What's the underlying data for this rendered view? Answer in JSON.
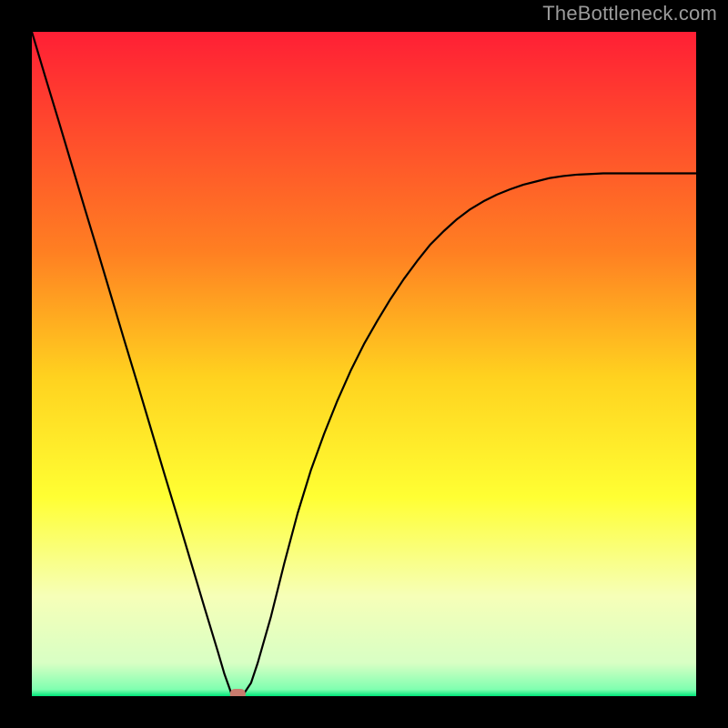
{
  "watermark": "TheBottleneck.com",
  "chart_data": {
    "type": "line",
    "title": "",
    "xlabel": "",
    "ylabel": "",
    "xlim": [
      0,
      100
    ],
    "ylim": [
      0,
      100
    ],
    "x": [
      0,
      2,
      4,
      6,
      8,
      10,
      12,
      14,
      16,
      18,
      20,
      22,
      24,
      26,
      28,
      29,
      30,
      31,
      32,
      33,
      34,
      36,
      38,
      40,
      42,
      44,
      46,
      48,
      50,
      52,
      54,
      56,
      58,
      60,
      62,
      64,
      66,
      68,
      70,
      72,
      74,
      76,
      78,
      80,
      82,
      84,
      86,
      88,
      90,
      92,
      94,
      96,
      98,
      100
    ],
    "values": [
      100,
      93.3,
      86.7,
      80.0,
      73.3,
      66.7,
      60.0,
      53.3,
      46.7,
      40.0,
      33.3,
      26.7,
      20.0,
      13.3,
      6.7,
      3.3,
      0.5,
      0.0,
      0.5,
      2.0,
      5.0,
      12.0,
      20.0,
      27.5,
      34.0,
      39.5,
      44.5,
      49.0,
      53.0,
      56.5,
      59.8,
      62.8,
      65.5,
      68.0,
      70.0,
      71.8,
      73.3,
      74.5,
      75.5,
      76.3,
      77.0,
      77.5,
      78.0,
      78.3,
      78.5,
      78.6,
      78.7,
      78.7,
      78.7,
      78.7,
      78.7,
      78.7,
      78.7,
      78.7
    ],
    "gradient_stops": [
      {
        "offset": 0.0,
        "color": "#ff1f35"
      },
      {
        "offset": 0.33,
        "color": "#ff7f22"
      },
      {
        "offset": 0.52,
        "color": "#ffd21f"
      },
      {
        "offset": 0.7,
        "color": "#ffff33"
      },
      {
        "offset": 0.85,
        "color": "#f6ffb8"
      },
      {
        "offset": 0.95,
        "color": "#d8ffc4"
      },
      {
        "offset": 0.99,
        "color": "#7fffb0"
      },
      {
        "offset": 1.0,
        "color": "#00e57a"
      }
    ],
    "marker": {
      "x": 31,
      "y": 0
    }
  }
}
